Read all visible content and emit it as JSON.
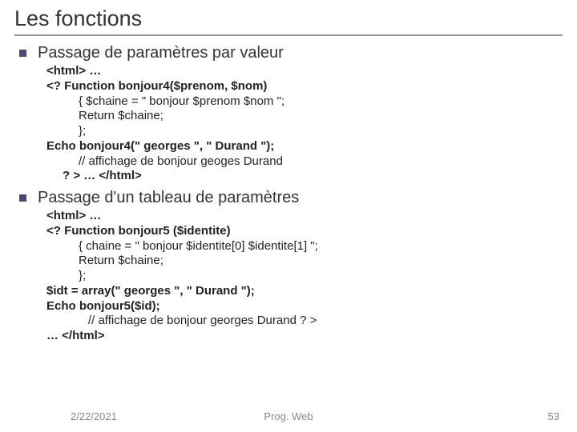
{
  "title": "Les fonctions",
  "section1": {
    "heading": "Passage de paramètres par valeur",
    "line1": "<html> …",
    "line2": "<? Function bonjour4($prenom, $nom)",
    "line3": "{ $chaine = \" bonjour $prenom $nom \";",
    "line4": "Return $chaine;",
    "line5": "};",
    "line6": "Echo bonjour4(\" georges \", \" Durand \");",
    "line7": "// affichage de bonjour geoges Durand",
    "line8": "? > … </html>"
  },
  "section2": {
    "heading": "Passage d'un tableau de paramètres",
    "line1": "<html> …",
    "line2": "<? Function bonjour5 ($identite)",
    "line3": "{ chaine = \" bonjour $identite[0] $identite[1] \";",
    "line4": "Return $chaine;",
    "line5": "};",
    "line6": "$idt = array(\" georges \", \" Durand \");",
    "line7": "Echo bonjour5($id);",
    "line8": "// affichage de bonjour georges Durand  ? >",
    "line9": "… </html>"
  },
  "footer": {
    "date": "2/22/2021",
    "center": "Prog. Web",
    "page": "53"
  }
}
